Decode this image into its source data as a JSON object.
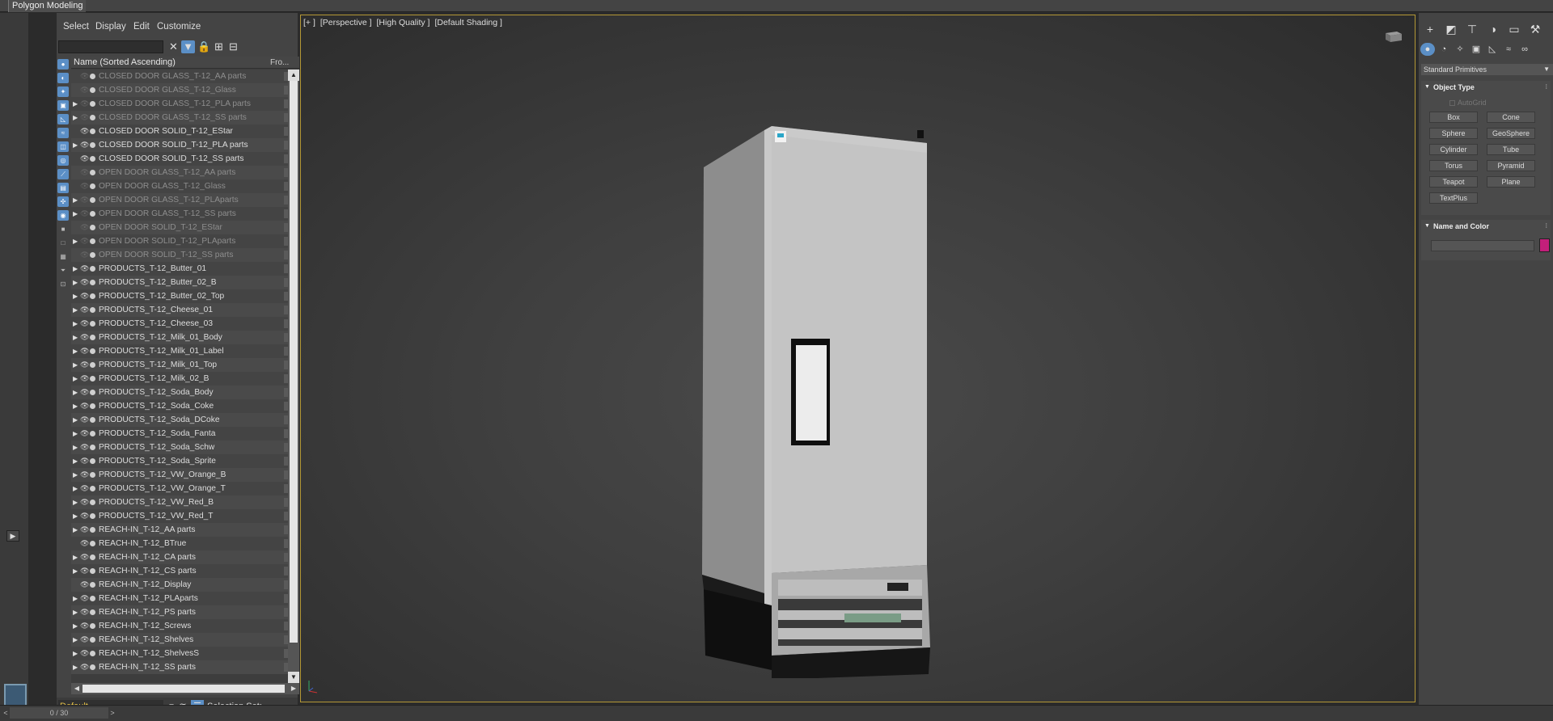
{
  "ribbon": {
    "tab_label": "Polygon Modeling"
  },
  "explorer": {
    "menu": [
      "Select",
      "Display",
      "Edit",
      "Customize"
    ],
    "header": {
      "name_col": "Name (Sorted Ascending)",
      "frozen_col": "Fro..."
    },
    "rows": [
      {
        "label": "CLOSED DOOR GLASS_T-12_AA parts",
        "expand": false,
        "type": "obj",
        "frozen": true
      },
      {
        "label": "CLOSED DOOR GLASS_T-12_Glass",
        "expand": false,
        "type": "obj",
        "frozen": true
      },
      {
        "label": "CLOSED DOOR GLASS_T-12_PLA parts",
        "expand": true,
        "type": "grp",
        "frozen": true
      },
      {
        "label": "CLOSED DOOR GLASS_T-12_SS parts",
        "expand": true,
        "type": "grp",
        "frozen": true
      },
      {
        "label": "CLOSED DOOR SOLID_T-12_EStar",
        "expand": false,
        "type": "obj",
        "frozen": false
      },
      {
        "label": "CLOSED DOOR SOLID_T-12_PLA parts",
        "expand": true,
        "type": "grp",
        "frozen": false
      },
      {
        "label": "CLOSED DOOR SOLID_T-12_SS parts",
        "expand": false,
        "type": "obj",
        "frozen": false
      },
      {
        "label": "OPEN DOOR GLASS_T-12_AA parts",
        "expand": false,
        "type": "obj",
        "frozen": true
      },
      {
        "label": "OPEN DOOR GLASS_T-12_Glass",
        "expand": false,
        "type": "obj",
        "frozen": true
      },
      {
        "label": "OPEN DOOR GLASS_T-12_PLAparts",
        "expand": true,
        "type": "grp",
        "frozen": true
      },
      {
        "label": "OPEN DOOR GLASS_T-12_SS parts",
        "expand": true,
        "type": "grp",
        "frozen": true
      },
      {
        "label": "OPEN DOOR SOLID_T-12_EStar",
        "expand": false,
        "type": "obj",
        "frozen": true
      },
      {
        "label": "OPEN DOOR SOLID_T-12_PLAparts",
        "expand": true,
        "type": "grp",
        "frozen": true
      },
      {
        "label": "OPEN DOOR SOLID_T-12_SS parts",
        "expand": false,
        "type": "obj",
        "frozen": true
      },
      {
        "label": "PRODUCTS_T-12_Butter_01",
        "expand": true,
        "type": "grp",
        "frozen": false
      },
      {
        "label": "PRODUCTS_T-12_Butter_02_B",
        "expand": true,
        "type": "grp",
        "frozen": false
      },
      {
        "label": "PRODUCTS_T-12_Butter_02_Top",
        "expand": true,
        "type": "grp",
        "frozen": false
      },
      {
        "label": "PRODUCTS_T-12_Cheese_01",
        "expand": true,
        "type": "grp",
        "frozen": false
      },
      {
        "label": "PRODUCTS_T-12_Cheese_03",
        "expand": true,
        "type": "grp",
        "frozen": false
      },
      {
        "label": "PRODUCTS_T-12_Milk_01_Body",
        "expand": true,
        "type": "grp",
        "frozen": false
      },
      {
        "label": "PRODUCTS_T-12_Milk_01_Label",
        "expand": true,
        "type": "grp",
        "frozen": false
      },
      {
        "label": "PRODUCTS_T-12_Milk_01_Top",
        "expand": true,
        "type": "grp",
        "frozen": false
      },
      {
        "label": "PRODUCTS_T-12_Milk_02_B",
        "expand": true,
        "type": "grp",
        "frozen": false
      },
      {
        "label": "PRODUCTS_T-12_Soda_Body",
        "expand": true,
        "type": "grp",
        "frozen": false
      },
      {
        "label": "PRODUCTS_T-12_Soda_Coke",
        "expand": true,
        "type": "grp",
        "frozen": false
      },
      {
        "label": "PRODUCTS_T-12_Soda_DCoke",
        "expand": true,
        "type": "grp",
        "frozen": false
      },
      {
        "label": "PRODUCTS_T-12_Soda_Fanta",
        "expand": true,
        "type": "grp",
        "frozen": false
      },
      {
        "label": "PRODUCTS_T-12_Soda_Schw",
        "expand": true,
        "type": "grp",
        "frozen": false
      },
      {
        "label": "PRODUCTS_T-12_Soda_Sprite",
        "expand": true,
        "type": "grp",
        "frozen": false
      },
      {
        "label": "PRODUCTS_T-12_VW_Orange_B",
        "expand": true,
        "type": "grp",
        "frozen": false
      },
      {
        "label": "PRODUCTS_T-12_VW_Orange_T",
        "expand": true,
        "type": "grp",
        "frozen": false
      },
      {
        "label": "PRODUCTS_T-12_VW_Red_B",
        "expand": true,
        "type": "grp",
        "frozen": false
      },
      {
        "label": "PRODUCTS_T-12_VW_Red_T",
        "expand": true,
        "type": "grp",
        "frozen": false
      },
      {
        "label": "REACH-IN_T-12_AA parts",
        "expand": true,
        "type": "grp",
        "frozen": false
      },
      {
        "label": "REACH-IN_T-12_BTrue",
        "expand": false,
        "type": "obj",
        "frozen": false
      },
      {
        "label": "REACH-IN_T-12_CA parts",
        "expand": true,
        "type": "grp",
        "frozen": false
      },
      {
        "label": "REACH-IN_T-12_CS parts",
        "expand": true,
        "type": "grp",
        "frozen": false
      },
      {
        "label": "REACH-IN_T-12_Display",
        "expand": false,
        "type": "obj",
        "frozen": false
      },
      {
        "label": "REACH-IN_T-12_PLAparts",
        "expand": true,
        "type": "grp",
        "frozen": false
      },
      {
        "label": "REACH-IN_T-12_PS parts",
        "expand": true,
        "type": "grp",
        "frozen": false
      },
      {
        "label": "REACH-IN_T-12_Screws",
        "expand": true,
        "type": "grp",
        "frozen": false
      },
      {
        "label": "REACH-IN_T-12_Shelves",
        "expand": true,
        "type": "grp",
        "frozen": false
      },
      {
        "label": "REACH-IN_T-12_ShelvesS",
        "expand": true,
        "type": "grp",
        "frozen": false
      },
      {
        "label": "REACH-IN_T-12_SS parts",
        "expand": true,
        "type": "grp",
        "frozen": false
      }
    ],
    "layer": "Default",
    "selection_set_label": "Selection Set:"
  },
  "status": {
    "progress": "0 / 30"
  },
  "viewport": {
    "labels": [
      "[+ ]",
      "[Perspective ]",
      "[High Quality ]",
      "[Default Shading ]"
    ]
  },
  "command_panel": {
    "category": "Standard Primitives",
    "object_type_title": "Object Type",
    "autogrid_label": "AutoGrid",
    "object_buttons": [
      "Box",
      "Cone",
      "Sphere",
      "GeoSphere",
      "Cylinder",
      "Tube",
      "Torus",
      "Pyramid",
      "Teapot",
      "Plane",
      "TextPlus"
    ],
    "name_color_title": "Name and Color",
    "object_color": "#c21f7a"
  }
}
